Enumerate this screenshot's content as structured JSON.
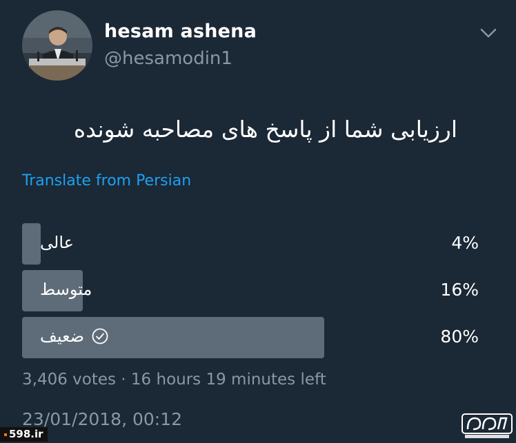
{
  "tweet": {
    "display_name": "hesam ashena",
    "handle": "@hesamodin1",
    "text": "ارزیابی شما از پاسخ های مصاحبه شونده",
    "translate_label": "Translate from Persian",
    "timestamp": "23/01/2018, 00:12"
  },
  "poll": {
    "options": [
      {
        "label": "عالی",
        "percent_label": "4%",
        "percent": 4,
        "selected": false
      },
      {
        "label": "متوسط",
        "percent_label": "16%",
        "percent": 16,
        "selected": false
      },
      {
        "label": "ضعیف",
        "percent_label": "80%",
        "percent": 80,
        "selected": true
      }
    ],
    "meta": "3,406 votes · 16 hours 19 minutes left"
  },
  "icons": {
    "caret": "chevron-down-icon",
    "selected": "check-circle-icon"
  },
  "watermark": {
    "left_text": "598.ir"
  },
  "colors": {
    "background": "#1b2836",
    "bar": "#5e6c7a",
    "link": "#1da1f2",
    "secondary_text": "#8899a6"
  }
}
